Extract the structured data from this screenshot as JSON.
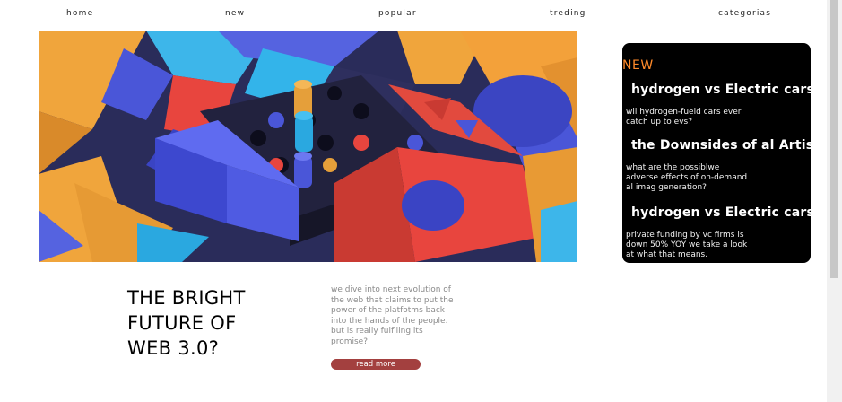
{
  "nav": {
    "items": [
      {
        "label": "home"
      },
      {
        "label": "new"
      },
      {
        "label": "popular"
      },
      {
        "label": "treding"
      },
      {
        "label": "categorias"
      }
    ]
  },
  "sidebar": {
    "badge": "NEW",
    "articles": [
      {
        "title": "hydrogen vs Electric cars",
        "desc": [
          "wil hydrogen-fueld cars ever",
          "catch up to evs?"
        ]
      },
      {
        "title": "the Downsides of al Artistry",
        "desc": [
          "what are the possiblwe",
          "adverse effects of on-demand",
          "al imag generation?"
        ]
      },
      {
        "title": "hydrogen vs Electric cars",
        "desc": [
          "private funding by vc firms is",
          "down 50% YOY we take a look",
          "at what that means."
        ]
      }
    ]
  },
  "main": {
    "headline": [
      "THE BRIGHT",
      "FUTURE OF",
      "WEB 3.0?"
    ],
    "summary": [
      "we dive into next evolution of",
      "the web that claims to put the",
      "power of the platfotms back",
      "into the hands of the people.",
      "but is really fulflling its",
      "promise?"
    ],
    "read_more": "read more"
  },
  "colors": {
    "accent": "#ff8a2a",
    "button": "#a3403f",
    "sidebar_bg": "#000000"
  }
}
